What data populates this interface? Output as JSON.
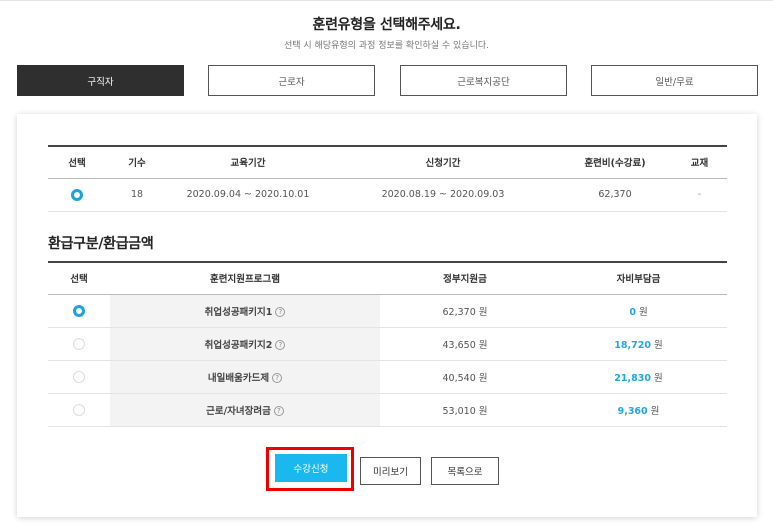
{
  "header": {
    "title": "훈련유형을 선택해주세요.",
    "subtitle": "선택 시 해당유형의 과정 정보를 확인하실 수 있습니다."
  },
  "tabs": [
    {
      "label": "구직자",
      "active": true
    },
    {
      "label": "근로자",
      "active": false
    },
    {
      "label": "근로복지공단",
      "active": false
    },
    {
      "label": "일반/무료",
      "active": false
    }
  ],
  "session_table": {
    "headers": [
      "선택",
      "기수",
      "교육기간",
      "신청기간",
      "훈련비(수강료)",
      "교재"
    ],
    "rows": [
      {
        "selected": true,
        "round": "18",
        "edu_period": "2020.09.04 ~ 2020.10.01",
        "apply_period": "2020.08.19 ~ 2020.09.03",
        "fee": "62,370",
        "textbook": "-"
      }
    ]
  },
  "refund": {
    "title": "환급구분/환급금액",
    "headers": [
      "선택",
      "훈련지원프로그램",
      "정부지원금",
      "자비부담금"
    ],
    "currency": "원",
    "rows": [
      {
        "selected": true,
        "program": "취업성공패키지1",
        "gov": "62,370",
        "self": "0"
      },
      {
        "selected": false,
        "program": "취업성공패키지2",
        "gov": "43,650",
        "self": "18,720"
      },
      {
        "selected": false,
        "program": "내일배움카드제",
        "gov": "40,540",
        "self": "21,830"
      },
      {
        "selected": false,
        "program": "근로/자녀장려금",
        "gov": "53,010",
        "self": "9,360"
      }
    ]
  },
  "buttons": {
    "apply": "수강신청",
    "preview": "미리보기",
    "list": "목록으로"
  },
  "colors": {
    "accent": "#1ab8ef",
    "highlight": "#e00000",
    "active_tab": "#2f2f2f"
  }
}
